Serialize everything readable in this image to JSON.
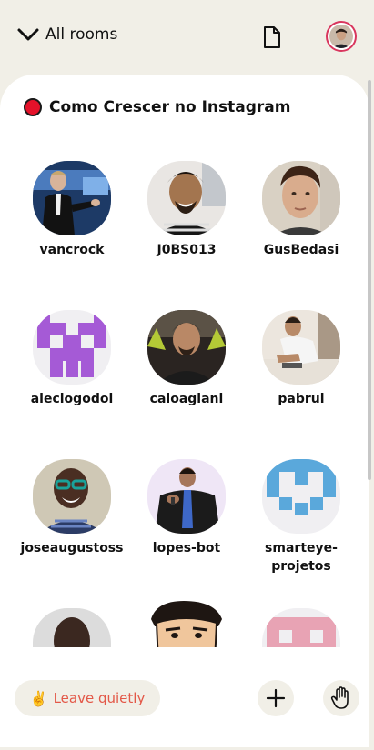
{
  "header": {
    "rooms_label": "All rooms",
    "chevron_icon": "chevron-down-icon",
    "document_icon": "document-icon",
    "profile_icon": "avatar"
  },
  "room": {
    "title": "Como Crescer no Instagram",
    "live_color": "#e4122a"
  },
  "speakers": [
    {
      "name": "vancrock",
      "avatar": "photo"
    },
    {
      "name": "J0BS013",
      "avatar": "photo"
    },
    {
      "name": "GusBedasi",
      "avatar": "photo"
    },
    {
      "name": "aleciogodoi",
      "avatar": "identicon-purple"
    },
    {
      "name": "caioagiani",
      "avatar": "photo"
    },
    {
      "name": "pabrul",
      "avatar": "photo"
    },
    {
      "name": "joseaugustoss",
      "avatar": "photo"
    },
    {
      "name": "lopes-bot",
      "avatar": "photo"
    },
    {
      "name": "smarteye-projetos",
      "avatar": "identicon-blue"
    },
    {
      "name": "",
      "avatar": "photo"
    },
    {
      "name": "",
      "avatar": "cartoon"
    },
    {
      "name": "",
      "avatar": "identicon-pink"
    }
  ],
  "footer": {
    "leave_emoji": "✌️",
    "leave_label": "Leave quietly",
    "add_icon": "plus-icon",
    "raise_hand_icon": "hand-icon"
  },
  "colors": {
    "background": "#f1efe7",
    "accent_red": "#e35848",
    "identicon_purple": "#a55ad6",
    "identicon_blue": "#5aa8db",
    "identicon_pink": "#e8a3b4"
  }
}
